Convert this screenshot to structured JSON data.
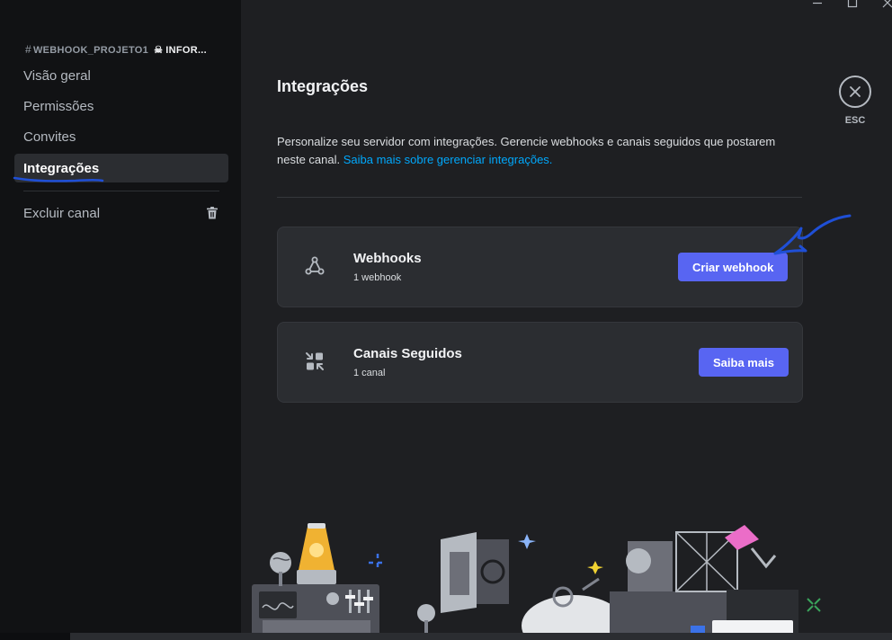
{
  "sidebar": {
    "channel_hash": "#",
    "channel_name": "WEBHOOK_PROJETO1",
    "channel_extra": "INFOR...",
    "items": [
      {
        "label": "Visão geral",
        "active": false
      },
      {
        "label": "Permissões",
        "active": false
      },
      {
        "label": "Convites",
        "active": false
      },
      {
        "label": "Integrações",
        "active": true
      },
      {
        "label": "Excluir canal",
        "icon": "trash-icon"
      }
    ]
  },
  "main": {
    "title": "Integrações",
    "description": "Personalize seu servidor com integrações. Gerencie webhooks e canais seguidos que postarem neste canal.",
    "description_link": "Saiba mais sobre gerenciar integrações.",
    "cards": [
      {
        "icon": "webhook-icon",
        "title": "Webhooks",
        "subtitle": "1 webhook",
        "button": "Criar webhook"
      },
      {
        "icon": "followed-channels-icon",
        "title": "Canais Seguidos",
        "subtitle": "1 canal",
        "button": "Saiba mais"
      }
    ]
  },
  "close": {
    "label": "ESC",
    "icon": "close-icon"
  },
  "window_controls": [
    "minimize-icon",
    "maximize-icon",
    "close-window-icon"
  ],
  "colors": {
    "accent": "#5865f2",
    "link": "#00a8fc",
    "annotation": "#1f4fd6"
  }
}
